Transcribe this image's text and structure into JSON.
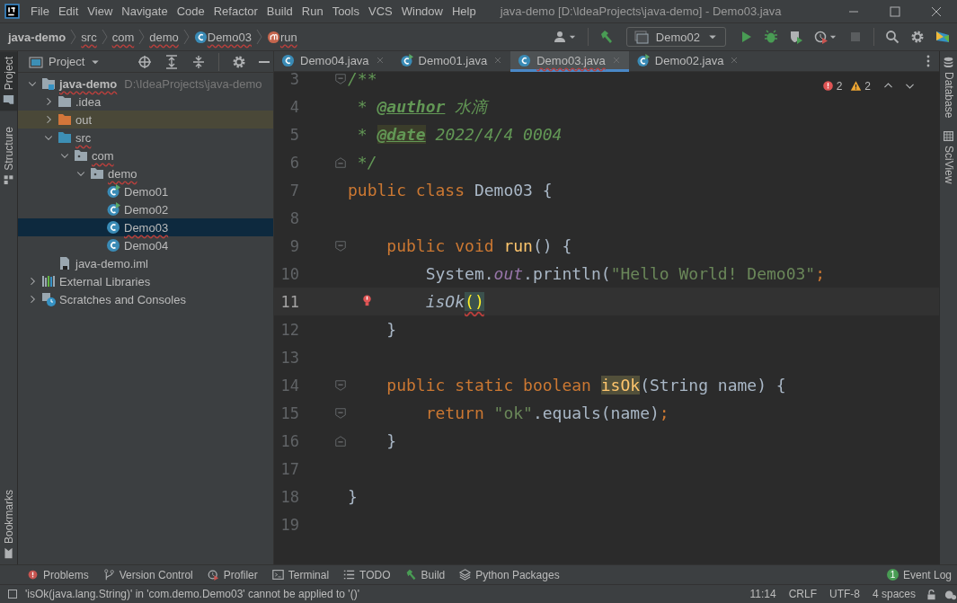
{
  "window": {
    "title": "java-demo [D:\\IdeaProjects\\java-demo] - Demo03.java"
  },
  "menu": [
    "File",
    "Edit",
    "View",
    "Navigate",
    "Code",
    "Refactor",
    "Build",
    "Run",
    "Tools",
    "VCS",
    "Window",
    "Help"
  ],
  "breadcrumbs": [
    {
      "label": "java-demo",
      "kind": "project",
      "error": false
    },
    {
      "label": "src",
      "kind": "plain",
      "error": true
    },
    {
      "label": "com",
      "kind": "plain",
      "error": true
    },
    {
      "label": "demo",
      "kind": "plain",
      "error": true
    },
    {
      "label": "Demo03",
      "kind": "class",
      "error": true
    },
    {
      "label": "run",
      "kind": "method",
      "error": true
    }
  ],
  "run_config": {
    "label": "Demo02"
  },
  "left_strip": {
    "top": [
      {
        "label": "Project",
        "kind": "project",
        "selected": true
      },
      {
        "label": "Structure",
        "kind": "structure",
        "selected": false
      }
    ],
    "bottom": [
      {
        "label": "Bookmarks",
        "kind": "bookmark",
        "selected": false
      }
    ]
  },
  "right_strip": [
    {
      "label": "Database",
      "kind": "database"
    },
    {
      "label": "SciView",
      "kind": "grid"
    }
  ],
  "project_panel": {
    "title": "Project",
    "tree": [
      {
        "label": "java-demo",
        "path": "D:\\IdeaProjects\\java-demo",
        "kind": "module",
        "expanded": true,
        "error": true,
        "selected": false,
        "highlighted": false,
        "children": [
          {
            "label": ".idea",
            "kind": "folder",
            "expanded": false,
            "error": false,
            "selected": false,
            "highlighted": false
          },
          {
            "label": "out",
            "kind": "folder-excluded",
            "expanded": false,
            "error": false,
            "selected": false,
            "highlighted": true
          },
          {
            "label": "src",
            "kind": "source-folder",
            "expanded": true,
            "error": true,
            "selected": false,
            "highlighted": false,
            "children": [
              {
                "label": "com",
                "kind": "package",
                "expanded": true,
                "error": true,
                "selected": false,
                "highlighted": false,
                "children": [
                  {
                    "label": "demo",
                    "kind": "package",
                    "expanded": true,
                    "error": true,
                    "selected": false,
                    "highlighted": false,
                    "children": [
                      {
                        "label": "Demo01",
                        "kind": "class-run",
                        "error": false,
                        "selected": false,
                        "highlighted": false
                      },
                      {
                        "label": "Demo02",
                        "kind": "class-run",
                        "error": false,
                        "selected": false,
                        "highlighted": false
                      },
                      {
                        "label": "Demo03",
                        "kind": "class",
                        "error": true,
                        "selected": true,
                        "highlighted": false
                      },
                      {
                        "label": "Demo04",
                        "kind": "class",
                        "error": false,
                        "selected": false,
                        "highlighted": false
                      }
                    ]
                  }
                ]
              }
            ]
          },
          {
            "label": "java-demo.iml",
            "kind": "file",
            "error": false,
            "selected": false,
            "highlighted": false
          }
        ]
      },
      {
        "label": "External Libraries",
        "kind": "libraries",
        "expanded": false,
        "error": false,
        "selected": false,
        "highlighted": false
      },
      {
        "label": "Scratches and Consoles",
        "kind": "scratches",
        "expanded": false,
        "error": false,
        "selected": false,
        "highlighted": false
      }
    ]
  },
  "editor": {
    "tabs": [
      {
        "label": "Demo04.java",
        "kind": "class",
        "selected": false,
        "error": false
      },
      {
        "label": "Demo01.java",
        "kind": "class-run",
        "selected": false,
        "error": false
      },
      {
        "label": "Demo03.java",
        "kind": "class",
        "selected": true,
        "error": true
      },
      {
        "label": "Demo02.java",
        "kind": "class-run",
        "selected": false,
        "error": false
      }
    ],
    "problems": {
      "errors": "2",
      "warnings": "2"
    },
    "lines": [
      {
        "number": "3",
        "current": false,
        "kind": "fold-start",
        "bulb": false,
        "tokens": [
          {
            "kind": "comment",
            "text": "/**"
          }
        ]
      },
      {
        "number": "4",
        "current": false,
        "bulb": false,
        "tokens": [
          {
            "kind": "comment",
            "text": " * "
          },
          {
            "kind": "doctag",
            "text": "@author"
          },
          {
            "kind": "comment",
            "text": " 水滴"
          }
        ]
      },
      {
        "number": "5",
        "current": false,
        "bulb": false,
        "tokens": [
          {
            "kind": "comment",
            "text": " * "
          },
          {
            "kind": "doctag-usage",
            "text": "@date"
          },
          {
            "kind": "comment",
            "text": " 2022/4/4 0004"
          }
        ]
      },
      {
        "number": "6",
        "current": false,
        "kind": "fold-end",
        "bulb": false,
        "tokens": [
          {
            "kind": "comment",
            "text": " */"
          }
        ]
      },
      {
        "number": "7",
        "current": false,
        "bulb": false,
        "tokens": [
          {
            "kind": "keyword",
            "text": "public class "
          },
          {
            "kind": "text",
            "text": "Demo03 {"
          }
        ]
      },
      {
        "number": "8",
        "current": false,
        "bulb": false
      },
      {
        "number": "9",
        "current": false,
        "kind": "fold-start",
        "bulb": false,
        "tokens": [
          {
            "kind": "keyword",
            "text": "    public void "
          },
          {
            "kind": "method-decl",
            "text": "run"
          },
          {
            "kind": "text",
            "text": "() {"
          }
        ]
      },
      {
        "number": "10",
        "current": false,
        "bulb": false,
        "tokens": [
          {
            "kind": "text",
            "text": "        System."
          },
          {
            "kind": "field",
            "text": "out"
          },
          {
            "kind": "text",
            "text": ".println("
          },
          {
            "kind": "string",
            "text": "\"Hello World! Demo03\""
          },
          {
            "kind": "punct",
            "text": ";"
          }
        ]
      },
      {
        "number": "11",
        "current": true,
        "bulb": true,
        "tokens": [
          {
            "kind": "static-call",
            "text": "        isOk"
          },
          {
            "kind": "brace-error",
            "text": "()"
          }
        ]
      },
      {
        "number": "12",
        "current": false,
        "bulb": false,
        "tokens": [
          {
            "kind": "text",
            "text": "    }"
          }
        ]
      },
      {
        "number": "13",
        "current": false,
        "bulb": false
      },
      {
        "number": "14",
        "current": false,
        "kind": "fold-start",
        "bulb": false,
        "tokens": [
          {
            "kind": "keyword",
            "text": "    public static boolean "
          },
          {
            "kind": "method-usage",
            "text": "isOk"
          },
          {
            "kind": "text",
            "text": "(String name) {"
          }
        ]
      },
      {
        "number": "15",
        "current": false,
        "kind": "fold-start",
        "bulb": false,
        "tokens": [
          {
            "kind": "keyword",
            "text": "        return "
          },
          {
            "kind": "string",
            "text": "\"ok\""
          },
          {
            "kind": "text",
            "text": ".equals(name)"
          },
          {
            "kind": "punct",
            "text": ";"
          }
        ]
      },
      {
        "number": "16",
        "current": false,
        "kind": "fold-end",
        "bulb": false,
        "tokens": [
          {
            "kind": "text",
            "text": "    }"
          }
        ]
      },
      {
        "number": "17",
        "current": false,
        "bulb": false
      },
      {
        "number": "18",
        "current": false,
        "bulb": false,
        "tokens": [
          {
            "kind": "text",
            "text": "}"
          }
        ]
      },
      {
        "number": "19",
        "current": false,
        "bulb": false
      }
    ]
  },
  "bottom_bar": {
    "tools": [
      {
        "label": "Problems",
        "kind": "problems"
      },
      {
        "label": "Version Control",
        "kind": "vcs"
      },
      {
        "label": "Profiler",
        "kind": "profiler"
      },
      {
        "label": "Terminal",
        "kind": "terminal"
      },
      {
        "label": "TODO",
        "kind": "todo"
      },
      {
        "label": "Build",
        "kind": "hammer"
      },
      {
        "label": "Python Packages",
        "kind": "layers"
      }
    ],
    "event_log": {
      "label": "Event Log",
      "badge": "1"
    }
  },
  "status_bar": {
    "message": "'isOk(java.lang.String)' in 'com.demo.Demo03' cannot be applied to '()'",
    "items": [
      "11:14",
      "CRLF",
      "UTF-8",
      "4 spaces"
    ]
  }
}
